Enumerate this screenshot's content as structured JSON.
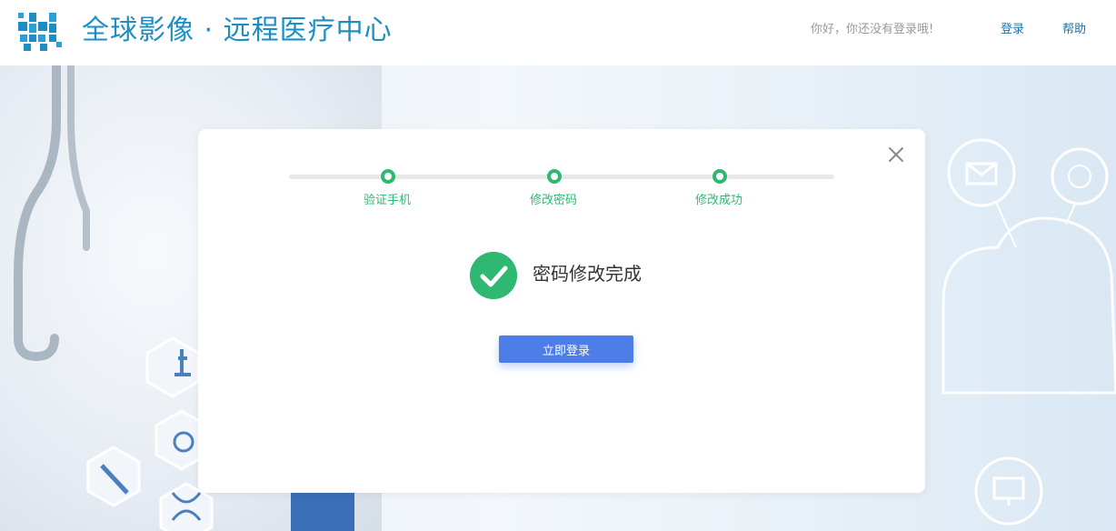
{
  "header": {
    "brand": "全球影像 · 远程医疗中心",
    "greeting": "你好，你还没有登录哦!",
    "nav": {
      "login": "登录",
      "help": "帮助"
    }
  },
  "modal": {
    "steps": [
      {
        "label": "验证手机"
      },
      {
        "label": "修改密码"
      },
      {
        "label": "修改成功"
      }
    ],
    "success_message": "密码修改完成",
    "login_button": "立即登录"
  },
  "colors": {
    "brand": "#1c8ec4",
    "step_green": "#2eb872",
    "button_blue": "#4d7de6"
  },
  "icons": {
    "logo": "logo-icon",
    "close": "close-icon",
    "success": "check-circle-icon"
  }
}
